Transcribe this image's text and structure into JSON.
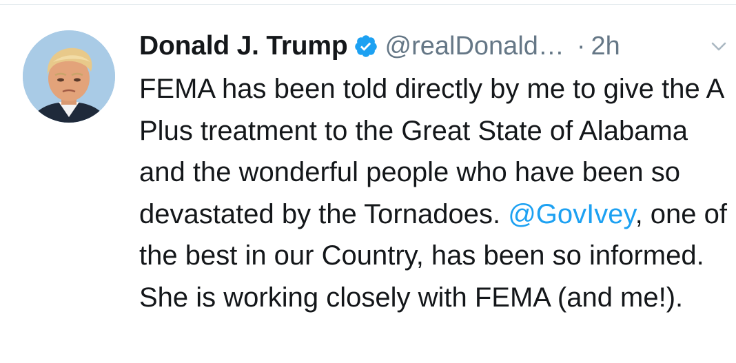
{
  "tweet": {
    "display_name": "Donald J. Trump",
    "handle": "@realDonald…",
    "separator": "·",
    "timestamp": "2h",
    "text_before_mention": "FEMA has been told directly by me to give the A Plus treatment to the Great State of Alabama and the wonderful people who have been so devastated by the Tornadoes. ",
    "mention": "@GovIvey",
    "text_after_mention": ", one of the best in our Country, has been so informed. She is working closely with FEMA (and me!).",
    "avatar_icon": "profile-photo",
    "verified_icon": "verified-badge-icon",
    "caret_icon": "chevron-down-icon"
  },
  "colors": {
    "text": "#14171a",
    "secondary": "#657786",
    "link": "#1da1f2",
    "verified": "#1da1f2"
  }
}
